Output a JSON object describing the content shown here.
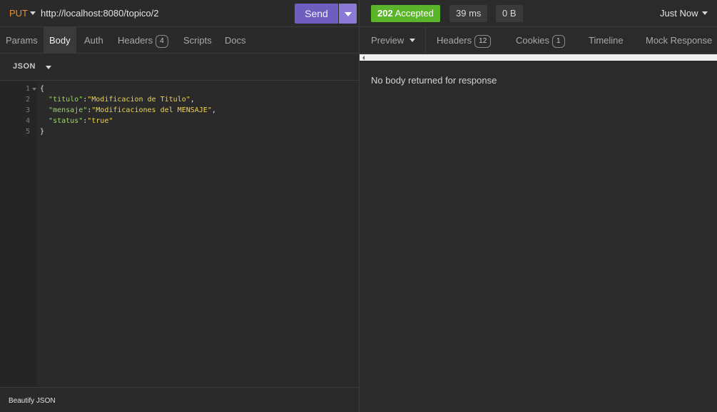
{
  "request": {
    "method": "PUT",
    "url": "http://localhost:8080/topico/2",
    "send_label": "Send"
  },
  "request_tabs": {
    "params": "Params",
    "body": "Body",
    "auth": "Auth",
    "headers": "Headers",
    "headers_count": "4",
    "scripts": "Scripts",
    "docs": "Docs"
  },
  "body_type": "JSON",
  "editor": {
    "line_numbers": [
      "1",
      "2",
      "3",
      "4",
      "5"
    ],
    "open_brace": "{",
    "close_brace": "}",
    "lines": [
      {
        "key": "\"titulo\"",
        "value": "\"Modificacion de Titulo\"",
        "trail": ","
      },
      {
        "key": "\"mensaje\"",
        "value": "\"Modificaciones del MENSAJE\"",
        "trail": ","
      },
      {
        "key": "\"status\"",
        "value": "\"true\"",
        "trail": ""
      }
    ]
  },
  "footer": {
    "beautify": "Beautify JSON"
  },
  "response": {
    "status_code": "202",
    "status_text": "Accepted",
    "time": "39 ms",
    "size": "0 B",
    "timestamp": "Just Now",
    "empty_message": "No body returned for response"
  },
  "response_tabs": {
    "preview": "Preview",
    "headers": "Headers",
    "headers_count": "12",
    "cookies": "Cookies",
    "cookies_count": "1",
    "timeline": "Timeline",
    "mock": "Mock Response"
  },
  "colors": {
    "method": "#e8912d",
    "send": "#6f5ec0",
    "status_ok": "#5ab52a",
    "json_key": "#9ed36a",
    "json_string": "#f0d34a"
  }
}
